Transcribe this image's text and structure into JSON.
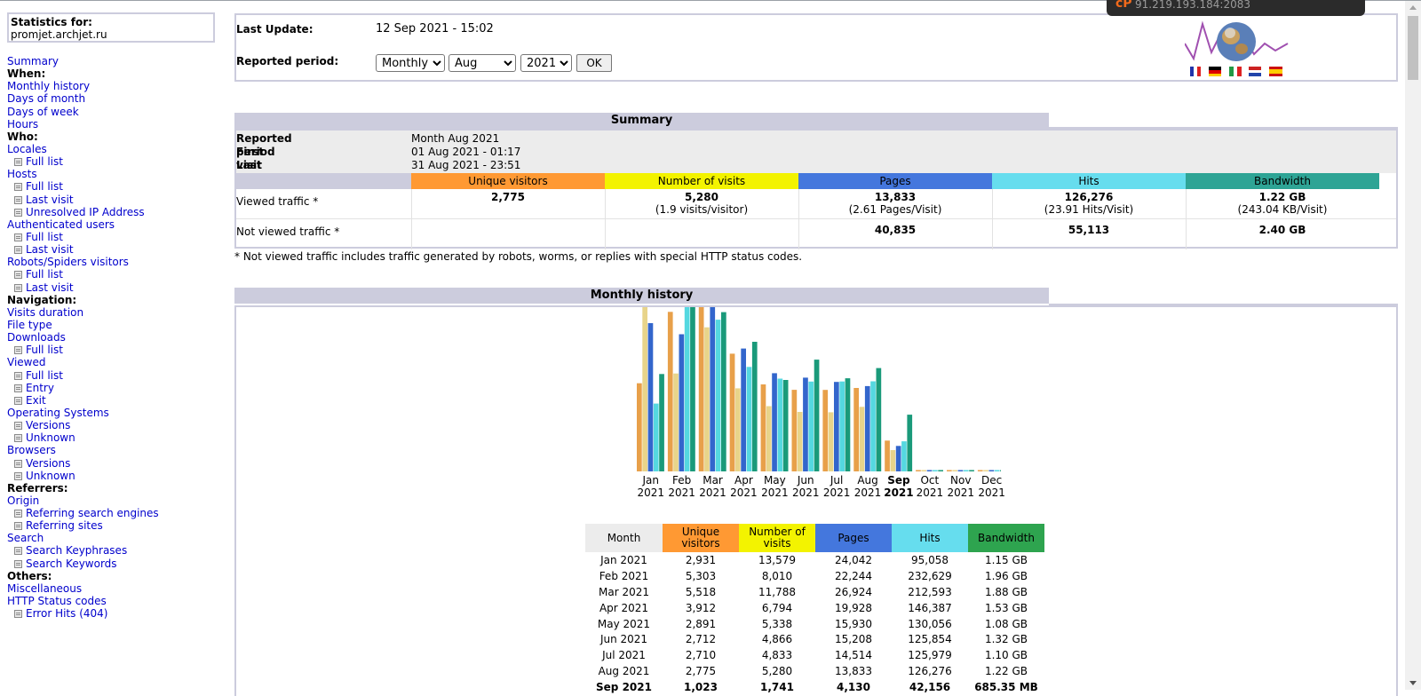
{
  "menu": {
    "stats_label": "Statistics for:",
    "site": "promjet.archjet.ru",
    "items": [
      {
        "t": "link",
        "label": "Summary"
      },
      {
        "t": "head",
        "label": "When:"
      },
      {
        "t": "link",
        "label": "Monthly history"
      },
      {
        "t": "link",
        "label": "Days of month"
      },
      {
        "t": "link",
        "label": "Days of week"
      },
      {
        "t": "link",
        "label": "Hours"
      },
      {
        "t": "head",
        "label": "Who:"
      },
      {
        "t": "link",
        "label": "Locales"
      },
      {
        "t": "sub",
        "label": "Full list"
      },
      {
        "t": "link",
        "label": "Hosts"
      },
      {
        "t": "sub",
        "label": "Full list"
      },
      {
        "t": "sub",
        "label": "Last visit"
      },
      {
        "t": "sub",
        "label": "Unresolved IP Address"
      },
      {
        "t": "link",
        "label": "Authenticated users"
      },
      {
        "t": "sub",
        "label": "Full list"
      },
      {
        "t": "sub",
        "label": "Last visit"
      },
      {
        "t": "link",
        "label": "Robots/Spiders visitors"
      },
      {
        "t": "sub",
        "label": "Full list"
      },
      {
        "t": "sub",
        "label": "Last visit"
      },
      {
        "t": "head",
        "label": "Navigation:"
      },
      {
        "t": "link",
        "label": "Visits duration"
      },
      {
        "t": "link",
        "label": "File type"
      },
      {
        "t": "link",
        "label": "Downloads"
      },
      {
        "t": "sub",
        "label": "Full list"
      },
      {
        "t": "link",
        "label": "Viewed"
      },
      {
        "t": "sub",
        "label": "Full list"
      },
      {
        "t": "sub",
        "label": "Entry"
      },
      {
        "t": "sub",
        "label": "Exit"
      },
      {
        "t": "link",
        "label": "Operating Systems"
      },
      {
        "t": "sub",
        "label": "Versions"
      },
      {
        "t": "sub",
        "label": "Unknown"
      },
      {
        "t": "link",
        "label": "Browsers"
      },
      {
        "t": "sub",
        "label": "Versions"
      },
      {
        "t": "sub",
        "label": "Unknown"
      },
      {
        "t": "head",
        "label": "Referrers:"
      },
      {
        "t": "link",
        "label": "Origin"
      },
      {
        "t": "sub",
        "label": "Referring search engines"
      },
      {
        "t": "sub",
        "label": "Referring sites"
      },
      {
        "t": "link",
        "label": "Search"
      },
      {
        "t": "sub",
        "label": "Search Keyphrases"
      },
      {
        "t": "sub",
        "label": "Search Keywords"
      },
      {
        "t": "head",
        "label": "Others:"
      },
      {
        "t": "link",
        "label": "Miscellaneous"
      },
      {
        "t": "link",
        "label": "HTTP Status codes"
      },
      {
        "t": "sub",
        "label": "Error Hits (404)"
      }
    ]
  },
  "header": {
    "last_update_label": "Last Update:",
    "last_update_value": "12 Sep 2021 - 15:02",
    "period_label": "Reported period:",
    "period_type": "Monthly",
    "period_month": "Aug",
    "period_year": "2021",
    "ok_label": "OK",
    "flags": [
      "fr",
      "de",
      "it",
      "nl",
      "es"
    ]
  },
  "summary": {
    "title": "Summary",
    "reported_period_label": "Reported period",
    "reported_period_value": "Month Aug 2021",
    "first_visit_label": "First visit",
    "first_visit_value": "01 Aug 2021 - 01:17",
    "last_visit_label": "Last visit",
    "last_visit_value": "31 Aug 2021 - 23:51",
    "columns": [
      {
        "label": "Unique visitors",
        "color": "#ff9933"
      },
      {
        "label": "Number of visits",
        "color": "#f3f300"
      },
      {
        "label": "Pages",
        "color": "#4477dd"
      },
      {
        "label": "Hits",
        "color": "#66ddee"
      },
      {
        "label": "Bandwidth",
        "color": "#2ea495"
      }
    ],
    "viewed_label": "Viewed traffic *",
    "viewed": [
      {
        "main": "2,775",
        "sub": ""
      },
      {
        "main": "5,280",
        "sub": "(1.9 visits/visitor)"
      },
      {
        "main": "13,833",
        "sub": "(2.61 Pages/Visit)"
      },
      {
        "main": "126,276",
        "sub": "(23.91 Hits/Visit)"
      },
      {
        "main": "1.22 GB",
        "sub": "(243.04 KB/Visit)"
      }
    ],
    "not_viewed_label": "Not viewed traffic *",
    "not_viewed": [
      "40,835",
      "55,113",
      "2.40 GB"
    ],
    "note": "* Not viewed traffic includes traffic generated by robots, worms, or replies with special HTTP status codes."
  },
  "history": {
    "title": "Monthly history",
    "table_headers": [
      "Month",
      "Unique visitors",
      "Number of visits",
      "Pages",
      "Hits",
      "Bandwidth"
    ],
    "rows": [
      [
        "Jan 2021",
        "2,931",
        "13,579",
        "24,042",
        "95,058",
        "1.15 GB"
      ],
      [
        "Feb 2021",
        "5,303",
        "8,010",
        "22,244",
        "232,629",
        "1.96 GB"
      ],
      [
        "Mar 2021",
        "5,518",
        "11,788",
        "26,924",
        "212,593",
        "1.88 GB"
      ],
      [
        "Apr 2021",
        "3,912",
        "6,794",
        "19,928",
        "146,387",
        "1.53 GB"
      ],
      [
        "May 2021",
        "2,891",
        "5,338",
        "15,930",
        "130,056",
        "1.08 GB"
      ],
      [
        "Jun 2021",
        "2,712",
        "4,866",
        "15,208",
        "125,854",
        "1.32 GB"
      ],
      [
        "Jul 2021",
        "2,710",
        "4,833",
        "14,514",
        "125,979",
        "1.10 GB"
      ],
      [
        "Aug 2021",
        "2,775",
        "5,280",
        "13,833",
        "126,276",
        "1.22 GB"
      ],
      [
        "Sep 2021",
        "1,023",
        "1,741",
        "4,130",
        "42,156",
        "685.35 MB"
      ]
    ]
  },
  "chart_data": {
    "type": "bar",
    "categories": [
      "Jan 2021",
      "Feb 2021",
      "Mar 2021",
      "Apr 2021",
      "May 2021",
      "Jun 2021",
      "Jul 2021",
      "Aug 2021",
      "Sep 2021",
      "Oct 2021",
      "Nov 2021",
      "Dec 2021"
    ],
    "month_labels": [
      "Jan",
      "Feb",
      "Mar",
      "Apr",
      "May",
      "Jun",
      "Jul",
      "Aug",
      "Sep",
      "Oct",
      "Nov",
      "Dec"
    ],
    "year_labels": [
      "2021",
      "2021",
      "2021",
      "2021",
      "2021",
      "2021",
      "2021",
      "2021",
      "2021",
      "2021",
      "2021",
      "2021"
    ],
    "current_index": 8,
    "series": [
      {
        "name": "Unique visitors",
        "values": [
          2931,
          5303,
          5518,
          3912,
          2891,
          2712,
          2710,
          2775,
          1023,
          0,
          0,
          0
        ]
      },
      {
        "name": "Number of visits",
        "values": [
          13579,
          8010,
          11788,
          6794,
          5338,
          4866,
          4833,
          5280,
          1741,
          0,
          0,
          0
        ]
      },
      {
        "name": "Pages",
        "values": [
          24042,
          22244,
          26924,
          19928,
          15930,
          15208,
          14514,
          13833,
          4130,
          0,
          0,
          0
        ]
      },
      {
        "name": "Hits",
        "values": [
          95058,
          232629,
          212593,
          146387,
          130056,
          125854,
          125979,
          126276,
          42156,
          0,
          0,
          0
        ]
      },
      {
        "name": "Bandwidth",
        "values": [
          1.15,
          1.96,
          1.88,
          1.53,
          1.08,
          1.32,
          1.1,
          1.22,
          0.67,
          0,
          0,
          0
        ]
      }
    ],
    "colors": [
      "#e8a04a",
      "#e8d48a",
      "#3366cc",
      "#55d8e0",
      "#1a9a7a"
    ]
  },
  "overlay": {
    "ip": "91.219.193.184:2083"
  }
}
